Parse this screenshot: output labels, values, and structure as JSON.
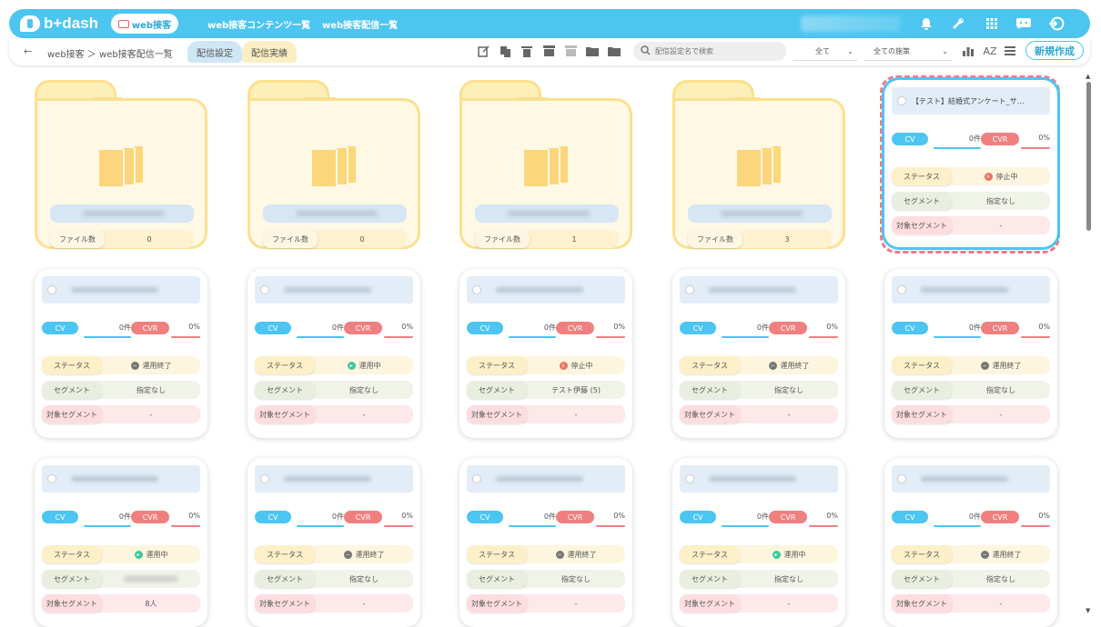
{
  "header": {
    "brand": "b+dash",
    "active_pill": "web接客",
    "nav": [
      "web接客コンテンツ一覧",
      "web接客配信一覧"
    ]
  },
  "toolbar": {
    "back": "←",
    "breadcrumb": "web接客 ＞ web接客配信一覧",
    "tabs": [
      "配信設定",
      "配信実績"
    ],
    "search_placeholder": "配信設定名で検索",
    "filter1": "全て",
    "filter2": "全ての施策",
    "sort_label": "AZ",
    "new_button": "新規作成"
  },
  "folders": [
    {
      "count_label": "ファイル数",
      "count": "0"
    },
    {
      "count_label": "ファイル数",
      "count": "0"
    },
    {
      "count_label": "ファイル数",
      "count": "1"
    },
    {
      "count_label": "ファイル数",
      "count": "3"
    }
  ],
  "labels": {
    "cv": "CV",
    "cvr": "CVR",
    "status": "ステータス",
    "segment": "セグメント",
    "target_segment": "対象セグメント"
  },
  "selected_card": {
    "title": "【テスト】結婚式アンケート_サ…",
    "cv": "0件",
    "cvr": "0%",
    "status": "停止中",
    "segment": "指定なし",
    "target_segment": "-"
  },
  "cards": [
    {
      "cv": "0件",
      "cvr": "0%",
      "status": "運用終了",
      "status_type": "end",
      "segment": "指定なし",
      "target_segment": "-"
    },
    {
      "cv": "0件",
      "cvr": "0%",
      "status": "運用中",
      "status_type": "run",
      "segment": "指定なし",
      "target_segment": "-"
    },
    {
      "cv": "0件",
      "cvr": "0%",
      "status": "停止中",
      "status_type": "stop",
      "segment": "テスト伊藤 (5)",
      "target_segment": "-"
    },
    {
      "cv": "0件",
      "cvr": "0%",
      "status": "運用終了",
      "status_type": "end",
      "segment": "指定なし",
      "target_segment": "-"
    },
    {
      "cv": "0件",
      "cvr": "0%",
      "status": "運用終了",
      "status_type": "end",
      "segment": "指定なし",
      "target_segment": "-"
    },
    {
      "cv": "0件",
      "cvr": "0%",
      "status": "運用中",
      "status_type": "run",
      "segment": "",
      "target_segment": "8人"
    },
    {
      "cv": "0件",
      "cvr": "0%",
      "status": "運用終了",
      "status_type": "end",
      "segment": "指定なし",
      "target_segment": "-"
    },
    {
      "cv": "0件",
      "cvr": "0%",
      "status": "運用終了",
      "status_type": "end",
      "segment": "指定なし",
      "target_segment": "-"
    },
    {
      "cv": "0件",
      "cvr": "0%",
      "status": "運用中",
      "status_type": "run",
      "segment": "指定なし",
      "target_segment": "-"
    },
    {
      "cv": "0件",
      "cvr": "0%",
      "status": "運用終了",
      "status_type": "end",
      "segment": "指定なし",
      "target_segment": "-"
    }
  ],
  "colors": {
    "accent": "#4cc5f0",
    "cvr": "#f08080",
    "folder": "#fbe08e"
  }
}
